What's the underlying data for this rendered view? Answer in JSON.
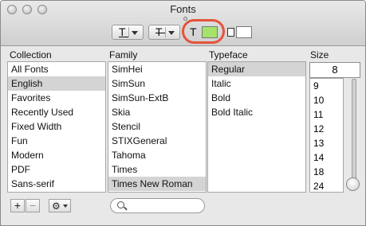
{
  "window": {
    "title": "Fonts"
  },
  "colors": {
    "text_color_swatch": "#a6e36a",
    "highlight_ring": "#e5533a"
  },
  "toolbar": {
    "underline_glyph": "T",
    "strike_glyph": "T",
    "text_color_glyph": "T"
  },
  "columns": {
    "collection": "Collection",
    "family": "Family",
    "typeface": "Typeface",
    "size": "Size"
  },
  "collections": [
    "All Fonts",
    "English",
    "Favorites",
    "Recently Used",
    "Fixed Width",
    "Fun",
    "Modern",
    "PDF",
    "Sans-serif"
  ],
  "families": [
    "SimHei",
    "SimSun",
    "SimSun-ExtB",
    "Skia",
    "Stencil",
    "STIXGeneral",
    "Tahoma",
    "Times",
    "Times New Roman"
  ],
  "typefaces": [
    "Regular",
    "Italic",
    "Bold",
    "Bold Italic"
  ],
  "size": {
    "value": "8",
    "options": [
      "9",
      "10",
      "11",
      "12",
      "13",
      "14",
      "18",
      "24"
    ]
  },
  "bottom": {
    "add_glyph": "+",
    "remove_glyph": "−",
    "gear_glyph": "⚙"
  },
  "search": {
    "placeholder": ""
  }
}
